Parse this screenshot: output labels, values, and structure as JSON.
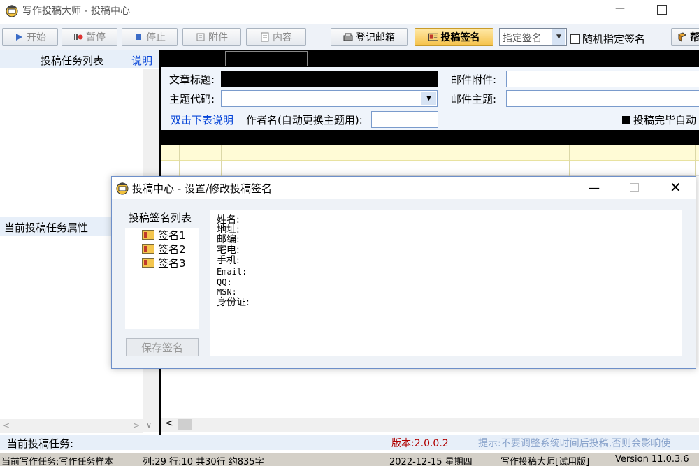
{
  "window": {
    "title": "写作投稿大师 - 投稿中心"
  },
  "toolbar": {
    "start": "开始",
    "pause": "暂停",
    "stop": "停止",
    "attach": "附件",
    "content": "内容",
    "register_mailbox": "登记邮箱",
    "submit_signature": "投稿签名",
    "signature_mode": "指定签名",
    "random_signature": "随机指定签名",
    "help_partial": "帮"
  },
  "left": {
    "task_list_title": "投稿任务列表",
    "help_link": "说明",
    "task_props_title": "当前投稿任务属性"
  },
  "form": {
    "article_title_label": "文章标题:",
    "topic_code_label": "主题代码:",
    "email_attach_label": "邮件附件:",
    "email_subject_label": "邮件主题:",
    "dblclick_help": "双击下表说明",
    "author_label": "作者名(自动更换主题用):",
    "auto_after_submit": "投稿完毕自动"
  },
  "bottom": {
    "current_task_label": "当前投稿任务:",
    "version": "版本:2.0.0.2",
    "hint": "提示:不要调整系统时间后投稿,否则会影响使"
  },
  "statusbar": {
    "current_writing": "当前写作任务:写作任务样本",
    "position": "列:29 行:10 共30行 约835字",
    "date": "2022-12-15 星期四",
    "app_trial": "写作投稿大师[试用版]",
    "version": "Version 11.0.3.6"
  },
  "dialog": {
    "title": "投稿中心 - 设置/修改投稿签名",
    "list_label": "投稿签名列表",
    "signatures": [
      "签名1",
      "签名2",
      "签名3"
    ],
    "save_button": "保存签名",
    "fields": {
      "name": "姓名:",
      "address": "地址:",
      "zip": "邮编:",
      "home_phone": "宅电:",
      "mobile": "手机:",
      "email": "Email:",
      "qq": "QQ:",
      "msn": "MSN:",
      "id_card": "身份证:"
    }
  }
}
